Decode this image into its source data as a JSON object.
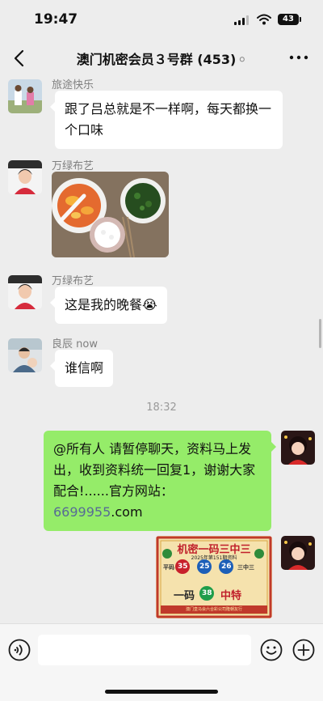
{
  "status": {
    "time": "19:47",
    "battery": "43"
  },
  "nav": {
    "title": "澳门机密会员３号群 (453)"
  },
  "messages": [
    {
      "sender": "旅途快乐",
      "text": "跟了吕总就是不一样啊，每天都换一个口味"
    },
    {
      "sender": "万绿布艺",
      "type": "image"
    },
    {
      "sender": "万绿布艺",
      "text": "这是我的晚餐😭"
    },
    {
      "sender": "良辰 now",
      "text": "谁信啊"
    }
  ],
  "timestamp": "18:32",
  "my_message": {
    "text_before": "@所有人 请暂停聊天，资料马上发出，收到资料统一回复1，谢谢大家配合!......官方网站：",
    "link": "6699955",
    "text_after": ".com"
  },
  "poster": {
    "title": "机密一码三中三",
    "subtitle": "2025年第151期资料",
    "label_left": "平码",
    "numbers": [
      "35",
      "25",
      "26"
    ],
    "label_right": "三中三",
    "bottom_left": "一码",
    "special": "38",
    "bottom_right": "中特",
    "footer": "澳门皇马会六合彩公司隆朝友行"
  },
  "icons": [
    "back-icon",
    "ear-icon",
    "more-icon",
    "voice-icon",
    "emoji-icon",
    "plus-icon"
  ]
}
